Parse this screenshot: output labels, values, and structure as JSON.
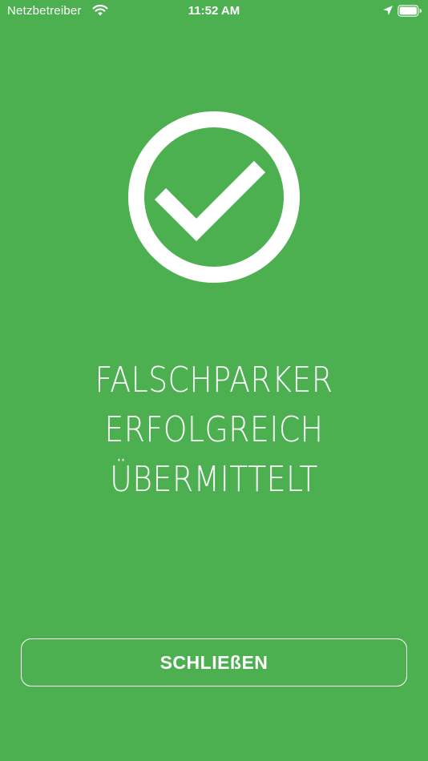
{
  "theme": {
    "background": "#4caf50",
    "foreground": "#ffffff"
  },
  "status_bar": {
    "carrier": "Netzbetreiber",
    "time": "11:52 AM",
    "icons": [
      "wifi-icon",
      "location-arrow-icon",
      "battery-icon"
    ]
  },
  "main": {
    "icon": "check-circle-icon",
    "message_lines": [
      "FALSCHPARKER",
      "ERFOLGREICH",
      "ÜBERMITTELT"
    ],
    "close_label": "SCHLIEßEN"
  }
}
